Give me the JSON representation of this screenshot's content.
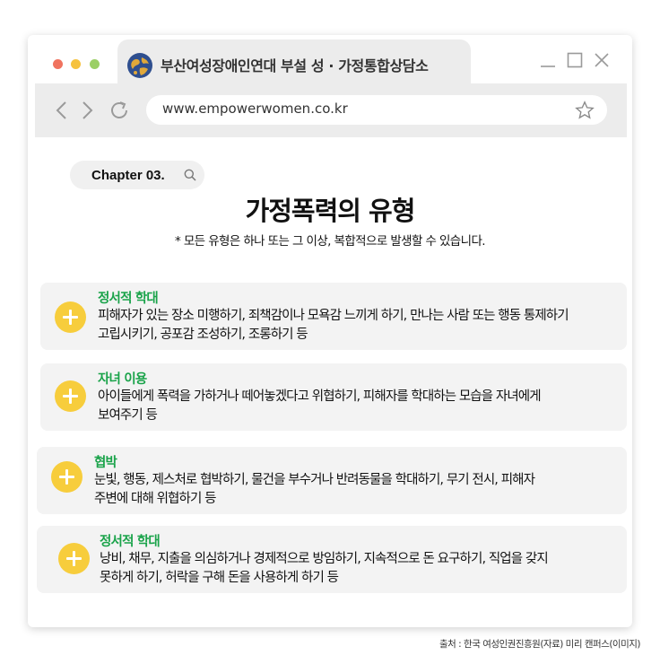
{
  "browser": {
    "tab_title": "부산여성장애인연대 부설 성 · 가정통합상담소",
    "url": "www.empowerwomen.co.kr"
  },
  "chapter": {
    "label": "Chapter 03."
  },
  "page": {
    "title": "가정폭력의 유형",
    "subtitle": "* 모든 유형은 하나 또는 그 이상, 복합적으로 발생할 수 있습니다."
  },
  "cards": [
    {
      "title": "정서적 학대",
      "line1": "피해자가 있는 장소 미행하기, 죄책감이나 모욕감 느끼게 하기, 만나는 사람 또는 행동 통제하기",
      "line2": "고립시키기, 공포감 조성하기, 조롱하기 등"
    },
    {
      "title": "자녀 이용",
      "line1": "아이들에게 폭력을 가하거나 떼어놓겠다고 위협하기, 피해자를 학대하는 모습을 자녀에게",
      "line2": "보여주기 등"
    },
    {
      "title": "협박",
      "line1": "눈빛, 행동, 제스처로 협박하기, 물건을 부수거나 반려동물을 학대하기, 무기  전시, 피해자",
      "line2": "주변에 대해 위협하기 등"
    },
    {
      "title": "정서적 학대",
      "line1": "낭비, 채무, 지출을 의심하거나 경제적으로 방임하기, 지속적으로 돈 요구하기, 직업을 갖지",
      "line2": "못하게 하기, 허락을 구해 돈을 사용하게 하기 등"
    }
  ],
  "footer": {
    "credit": "출처 : 한국 여성인권진흥원(자료) 미리 캔퍼스(이미지)"
  },
  "colors": {
    "accent_green": "#1aa34a",
    "plus_yellow": "#f7cd3c",
    "card_bg": "#f3f3f3"
  },
  "icons": [
    "close-dot",
    "minimize-dot",
    "maximize-dot",
    "globe-favicon",
    "minimize-icon",
    "maximize-icon",
    "close-icon",
    "back-icon",
    "forward-icon",
    "reload-icon",
    "star-icon",
    "search-icon",
    "plus-icon"
  ]
}
